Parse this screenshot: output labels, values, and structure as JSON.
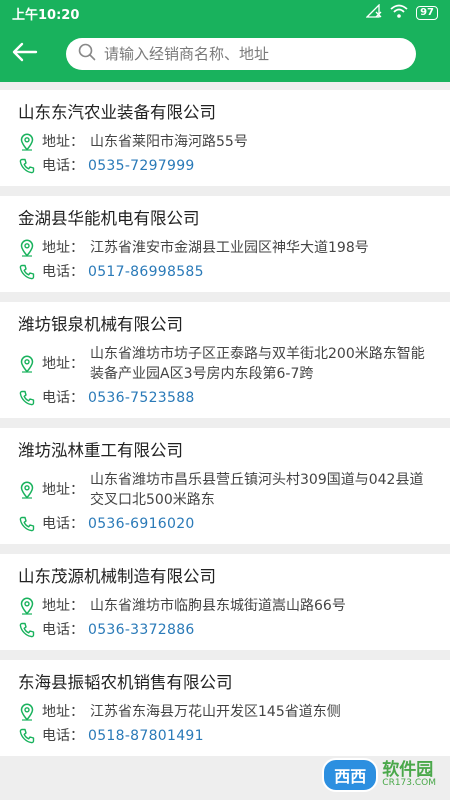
{
  "status_bar": {
    "time": "上午10:20",
    "battery": "97"
  },
  "header": {
    "back_icon": "back-arrow-icon",
    "search_placeholder": "请输入经销商名称、地址"
  },
  "labels": {
    "address": "地址：",
    "phone": "电话："
  },
  "dealers": [
    {
      "name": "山东东汽农业装备有限公司",
      "address": "山东省莱阳市海河路55号",
      "phone": "0535-7297999"
    },
    {
      "name": "金湖县华能机电有限公司",
      "address": "江苏省淮安市金湖县工业园区神华大道198号",
      "phone": "0517-86998585"
    },
    {
      "name": "潍坊银泉机械有限公司",
      "address": "山东省潍坊市坊子区正泰路与双羊街北200米路东智能装备产业园A区3号房内东段第6-7跨",
      "phone": "0536-7523588"
    },
    {
      "name": "潍坊泓林重工有限公司",
      "address": "山东省潍坊市昌乐县营丘镇河头村309国道与042县道交叉口北500米路东",
      "phone": "0536-6916020"
    },
    {
      "name": "山东茂源机械制造有限公司",
      "address": "山东省潍坊市临朐县东城街道嵩山路66号",
      "phone": "0536-3372886"
    },
    {
      "name": "东海县振韬农机销售有限公司",
      "address": "江苏省东海县万花山开发区145省道东侧",
      "phone": "0518-87801491"
    }
  ],
  "watermark": {
    "brand": "西西",
    "text": "软件园",
    "site": "CR173.COM"
  },
  "colors": {
    "header_green": "#19b25d",
    "icon_green": "#19b25d",
    "phone_blue": "#2a7ab8"
  }
}
